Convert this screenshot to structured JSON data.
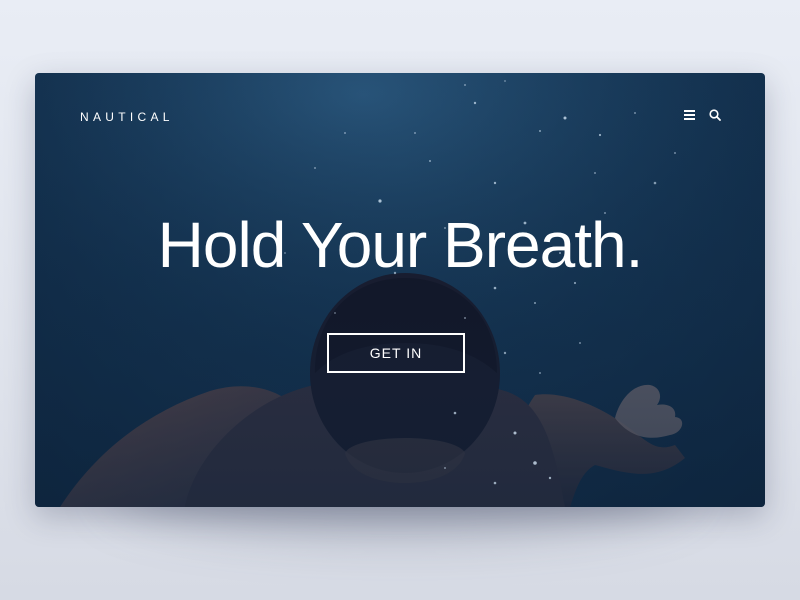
{
  "brand": {
    "name": "NAUTICAL"
  },
  "nav": {
    "menu_icon": "menu-icon",
    "search_icon": "search-icon"
  },
  "hero": {
    "headline": "Hold Your Breath.",
    "cta_label": "GET IN",
    "background_color": "#15375a"
  }
}
